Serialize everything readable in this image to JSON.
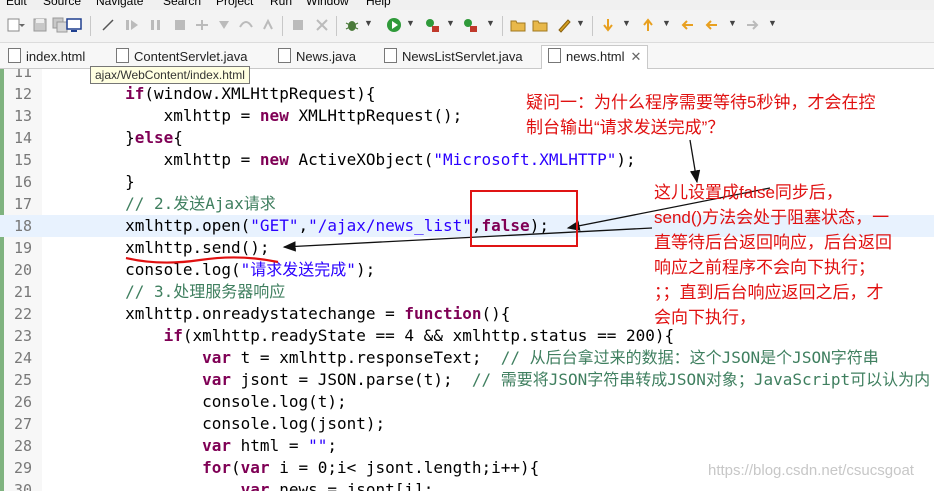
{
  "menubar": [
    "Edit",
    "Source",
    "Navigate",
    "Search",
    "Project",
    "Run",
    "Window",
    "Help"
  ],
  "tabs": [
    "index.html",
    "ContentServlet.java",
    "News.java",
    "NewsListServlet.java",
    "news.html"
  ],
  "tooltip": "ajax/WebContent/index.html",
  "code": [
    {
      "n": "11",
      "t": ""
    },
    {
      "n": "12",
      "t": "        if(window.XMLHttpRequest){"
    },
    {
      "n": "13",
      "t": "            xmlhttp = new XMLHttpRequest();"
    },
    {
      "n": "14",
      "t": "        }else{"
    },
    {
      "n": "15",
      "t": "            xmlhttp = new ActiveXObject(\"Microsoft.XMLHTTP\");"
    },
    {
      "n": "16",
      "t": "        }"
    },
    {
      "n": "17",
      "t": "        // 2.发送Ajax请求"
    },
    {
      "n": "18",
      "t": "        xmlhttp.open(\"GET\",\"/ajax/news_list\",false);"
    },
    {
      "n": "19",
      "t": "        xmlhttp.send();"
    },
    {
      "n": "20",
      "t": "        console.log(\"请求发送完成\");"
    },
    {
      "n": "21",
      "t": "        // 3.处理服务器响应"
    },
    {
      "n": "22",
      "t": "        xmlhttp.onreadystatechange = function(){"
    },
    {
      "n": "23",
      "t": "            if(xmlhttp.readyState == 4 && xmlhttp.status == 200){"
    },
    {
      "n": "24",
      "t": "                var t = xmlhttp.responseText;  // 从后台拿过来的数据：这个JSON是个JSON字符串"
    },
    {
      "n": "25",
      "t": "                var jsont = JSON.parse(t);  // 需要将JSON字符串转成JSON对象；JavaScript可以认为内"
    },
    {
      "n": "26",
      "t": "                console.log(t);"
    },
    {
      "n": "27",
      "t": "                console.log(jsont);"
    },
    {
      "n": "28",
      "t": "                var html = \"\";"
    },
    {
      "n": "29",
      "t": "                for(var i = 0;i< jsont.length;i++){"
    },
    {
      "n": "30",
      "t": "                    var news = jsont[i];"
    }
  ],
  "annotations": {
    "question": [
      "疑问一：为什么程序需要等待5秒钟，才会在控",
      "制台输出“请求发送完成”？"
    ],
    "explain": [
      "这儿设置成false同步后，",
      "send()方法会处于阻塞状态，一",
      "直等待后台返回响应，后台返回",
      "响应之前程序不会向下执行；",
      "；；直到后台响应返回之后，才",
      "会向下执行，"
    ]
  },
  "watermark": "https://blog.csdn.net/csucsgoat",
  "colors": {
    "keyword": "#7f0055",
    "string": "#2a00ff",
    "comment": "#3f7f5f",
    "annotation": "#e01010",
    "current_line": "#e8f2fe"
  }
}
